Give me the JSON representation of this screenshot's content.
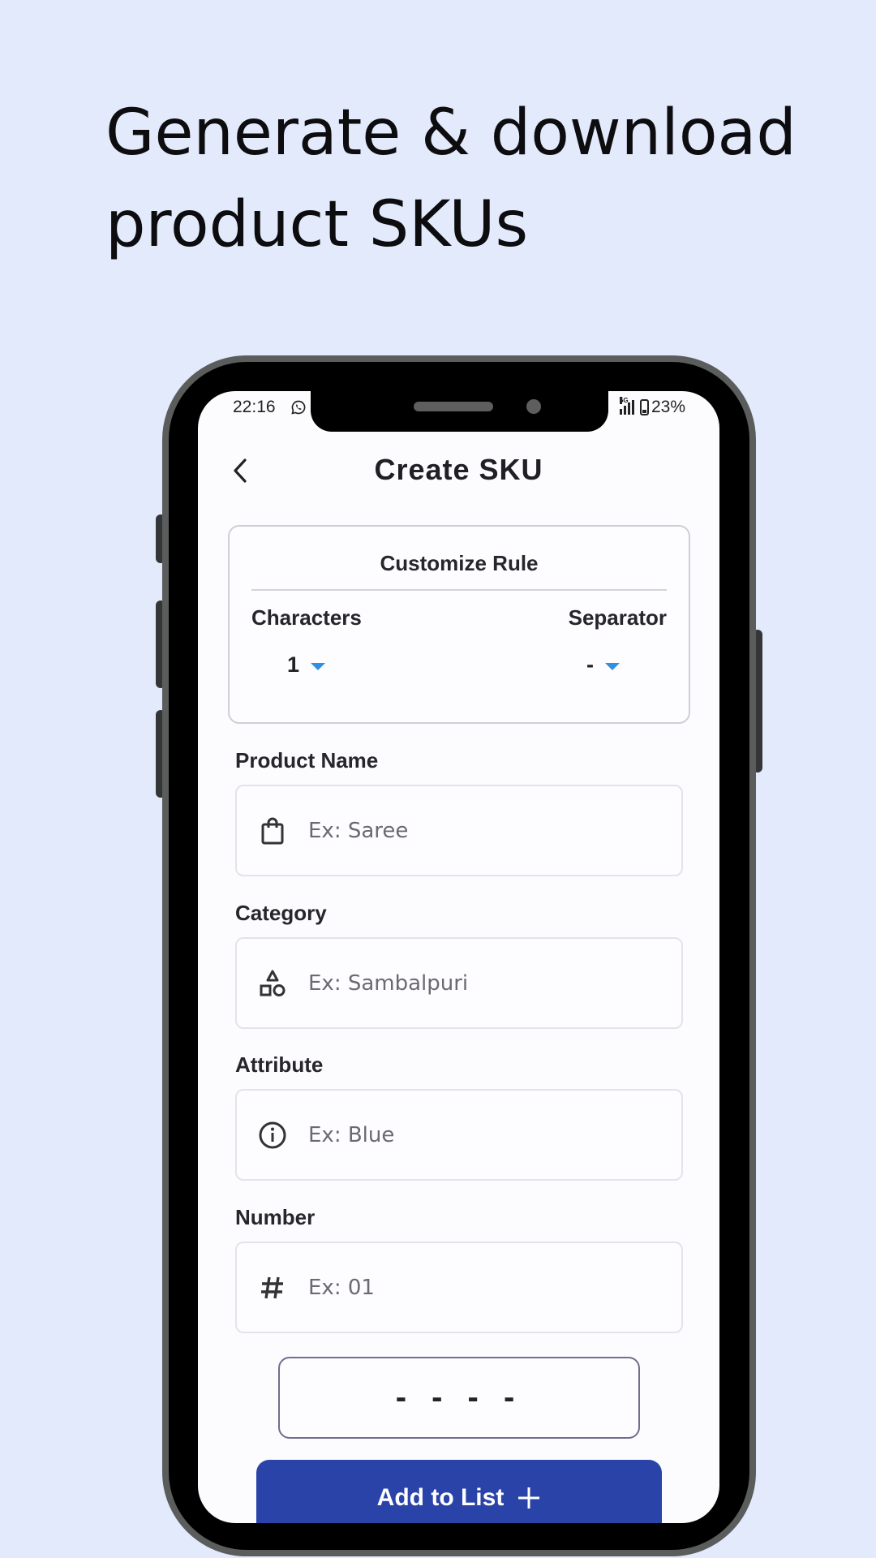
{
  "promo": {
    "headline_line1": "Generate & download",
    "headline_line2": "product SKUs"
  },
  "status_bar": {
    "time": "22:16",
    "notification_icon": "whatsapp-icon",
    "network": "5G",
    "battery": "23%"
  },
  "header": {
    "back_icon": "chevron-left-icon",
    "title": "Create SKU"
  },
  "rule_card": {
    "title": "Customize Rule",
    "characters_label": "Characters",
    "characters_value": "1",
    "separator_label": "Separator",
    "separator_value": "-"
  },
  "fields": [
    {
      "label": "Product Name",
      "placeholder": "Ex: Saree",
      "value": "",
      "icon": "shopping-bag-icon"
    },
    {
      "label": "Category",
      "placeholder": "Ex: Sambalpuri",
      "value": "",
      "icon": "shapes-icon"
    },
    {
      "label": "Attribute",
      "placeholder": "Ex: Blue",
      "value": "",
      "icon": "info-icon"
    },
    {
      "label": "Number",
      "placeholder": "Ex: 01",
      "value": "",
      "icon": "hash-icon"
    }
  ],
  "sku_preview": "- - - -",
  "add_button": {
    "label": "Add to List",
    "icon": "plus-icon"
  },
  "colors": {
    "background": "#e3eafc",
    "primary": "#2a43a8",
    "dropdown_accent": "#2f8fe0"
  }
}
